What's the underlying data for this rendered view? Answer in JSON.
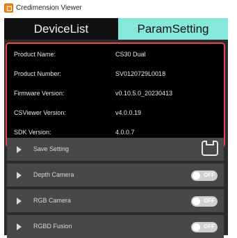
{
  "window": {
    "title": "Credimension Viewer"
  },
  "tabs": [
    {
      "label": "DeviceList",
      "active": false
    },
    {
      "label": "ParamSetting",
      "active": true
    }
  ],
  "info": [
    {
      "label": "Product Name:",
      "value": "CS30 Dual"
    },
    {
      "label": "Product Number:",
      "value": "SV0120729L0018"
    },
    {
      "label": "Firmware Version:",
      "value": "v0.10.5.0_20230413"
    },
    {
      "label": "CSViewer Version:",
      "value": "v4.0.0.19"
    },
    {
      "label": "SDK Version:",
      "value": "4.0.0.7"
    }
  ],
  "sections": {
    "save": {
      "label": "Save Setting"
    },
    "depth": {
      "label": "Depth Camera",
      "toggle": "OFF"
    },
    "rgb": {
      "label": "RGB Camera",
      "toggle": "OFF"
    },
    "rgbd": {
      "label": "RGBD Fusion",
      "toggle": "OFF"
    }
  },
  "colors": {
    "active_tab": "#86e8d8",
    "info_border": "#e04a4a",
    "panel_bg": "#2b2b2b",
    "section_bg": "#484848"
  }
}
